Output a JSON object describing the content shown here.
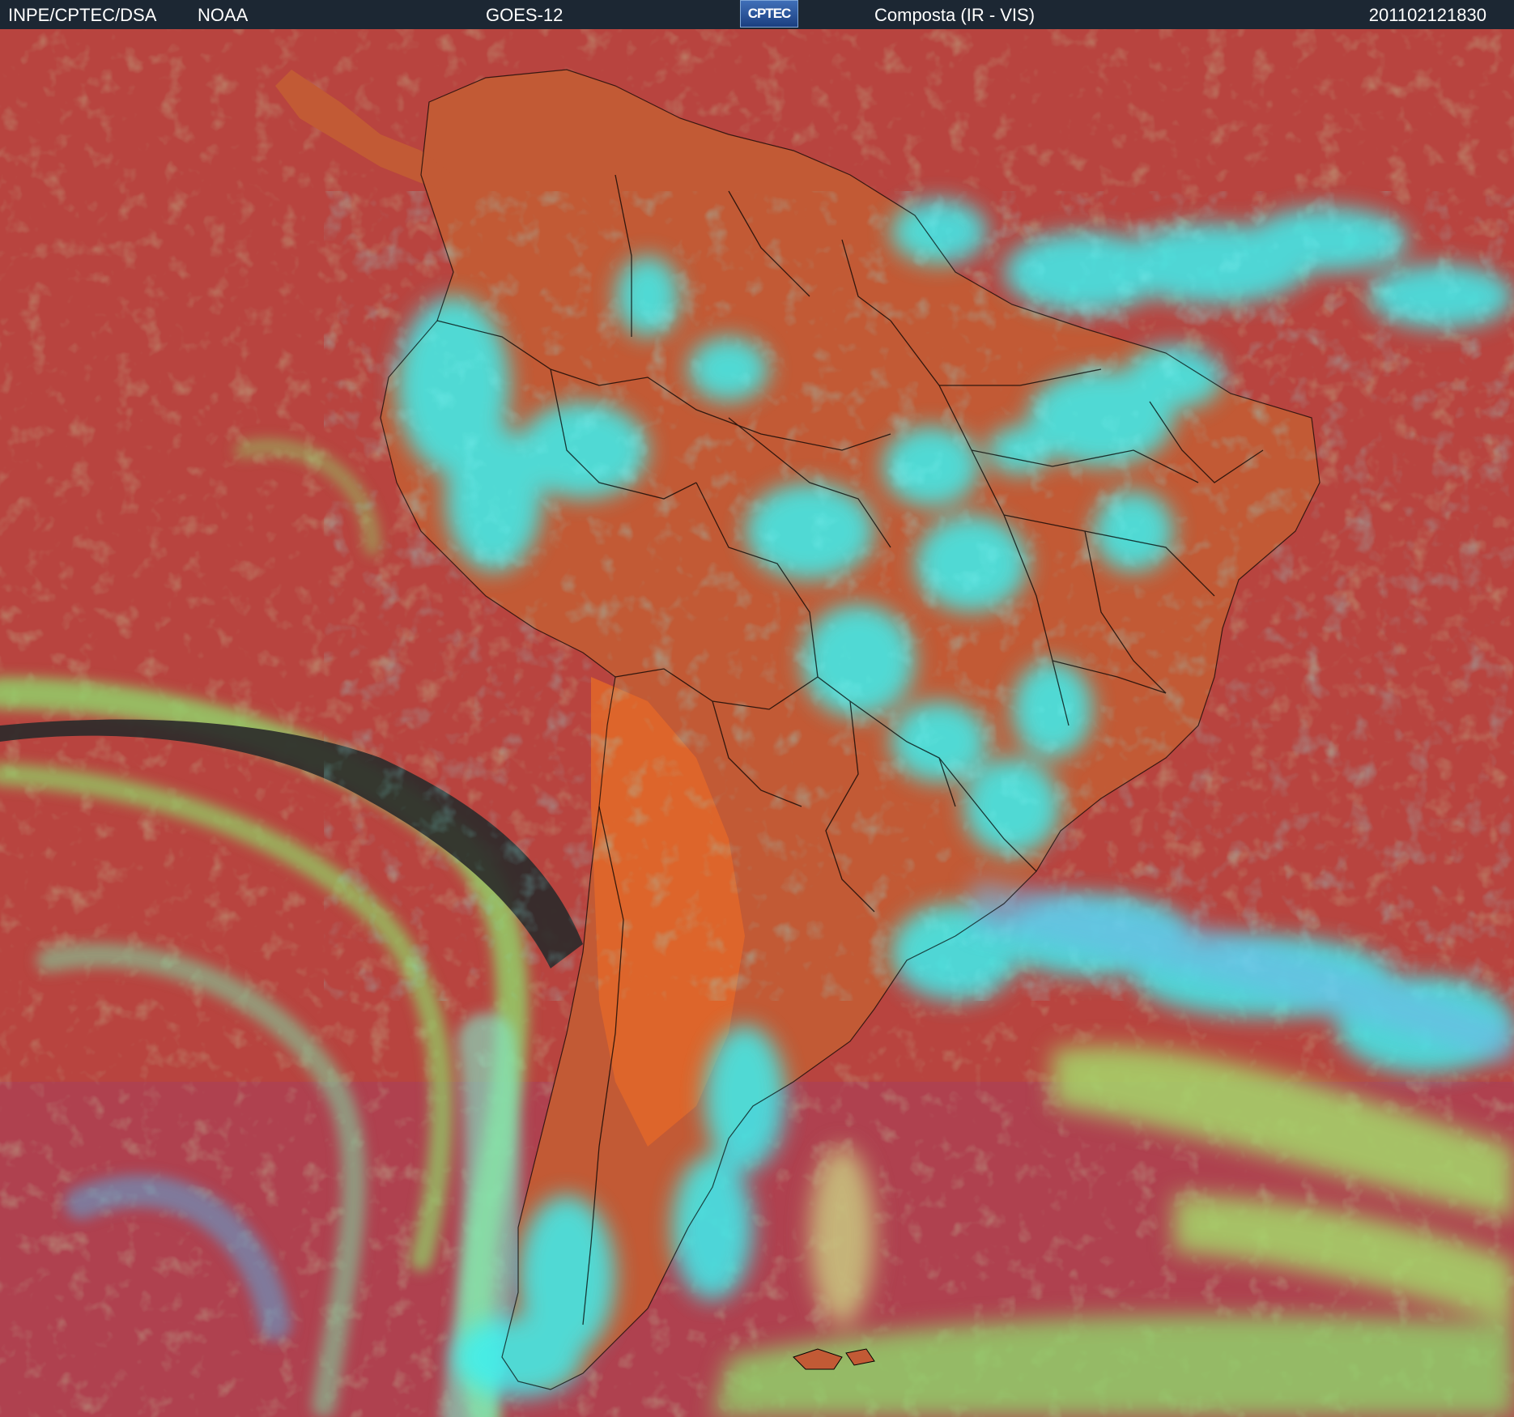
{
  "header": {
    "source": "INPE/CPTEC/DSA",
    "agency": "NOAA",
    "satellite": "GOES-12",
    "logo_text": "CPTEC",
    "product": "Composta (IR - VIS)",
    "timestamp": "201102121830"
  },
  "colors": {
    "header_bg": "#1c2733",
    "ocean": "#b8443f",
    "land": "#c25a35",
    "andes": "#e0662a",
    "cloud_cold": "#3cf0f0",
    "cloud_low": "#8ed86a",
    "cloud_blue": "#4f8ec8",
    "clear_dark": "#2a2a2a",
    "borders": "#000000"
  },
  "map": {
    "icon": "south-america-satellite-image"
  }
}
